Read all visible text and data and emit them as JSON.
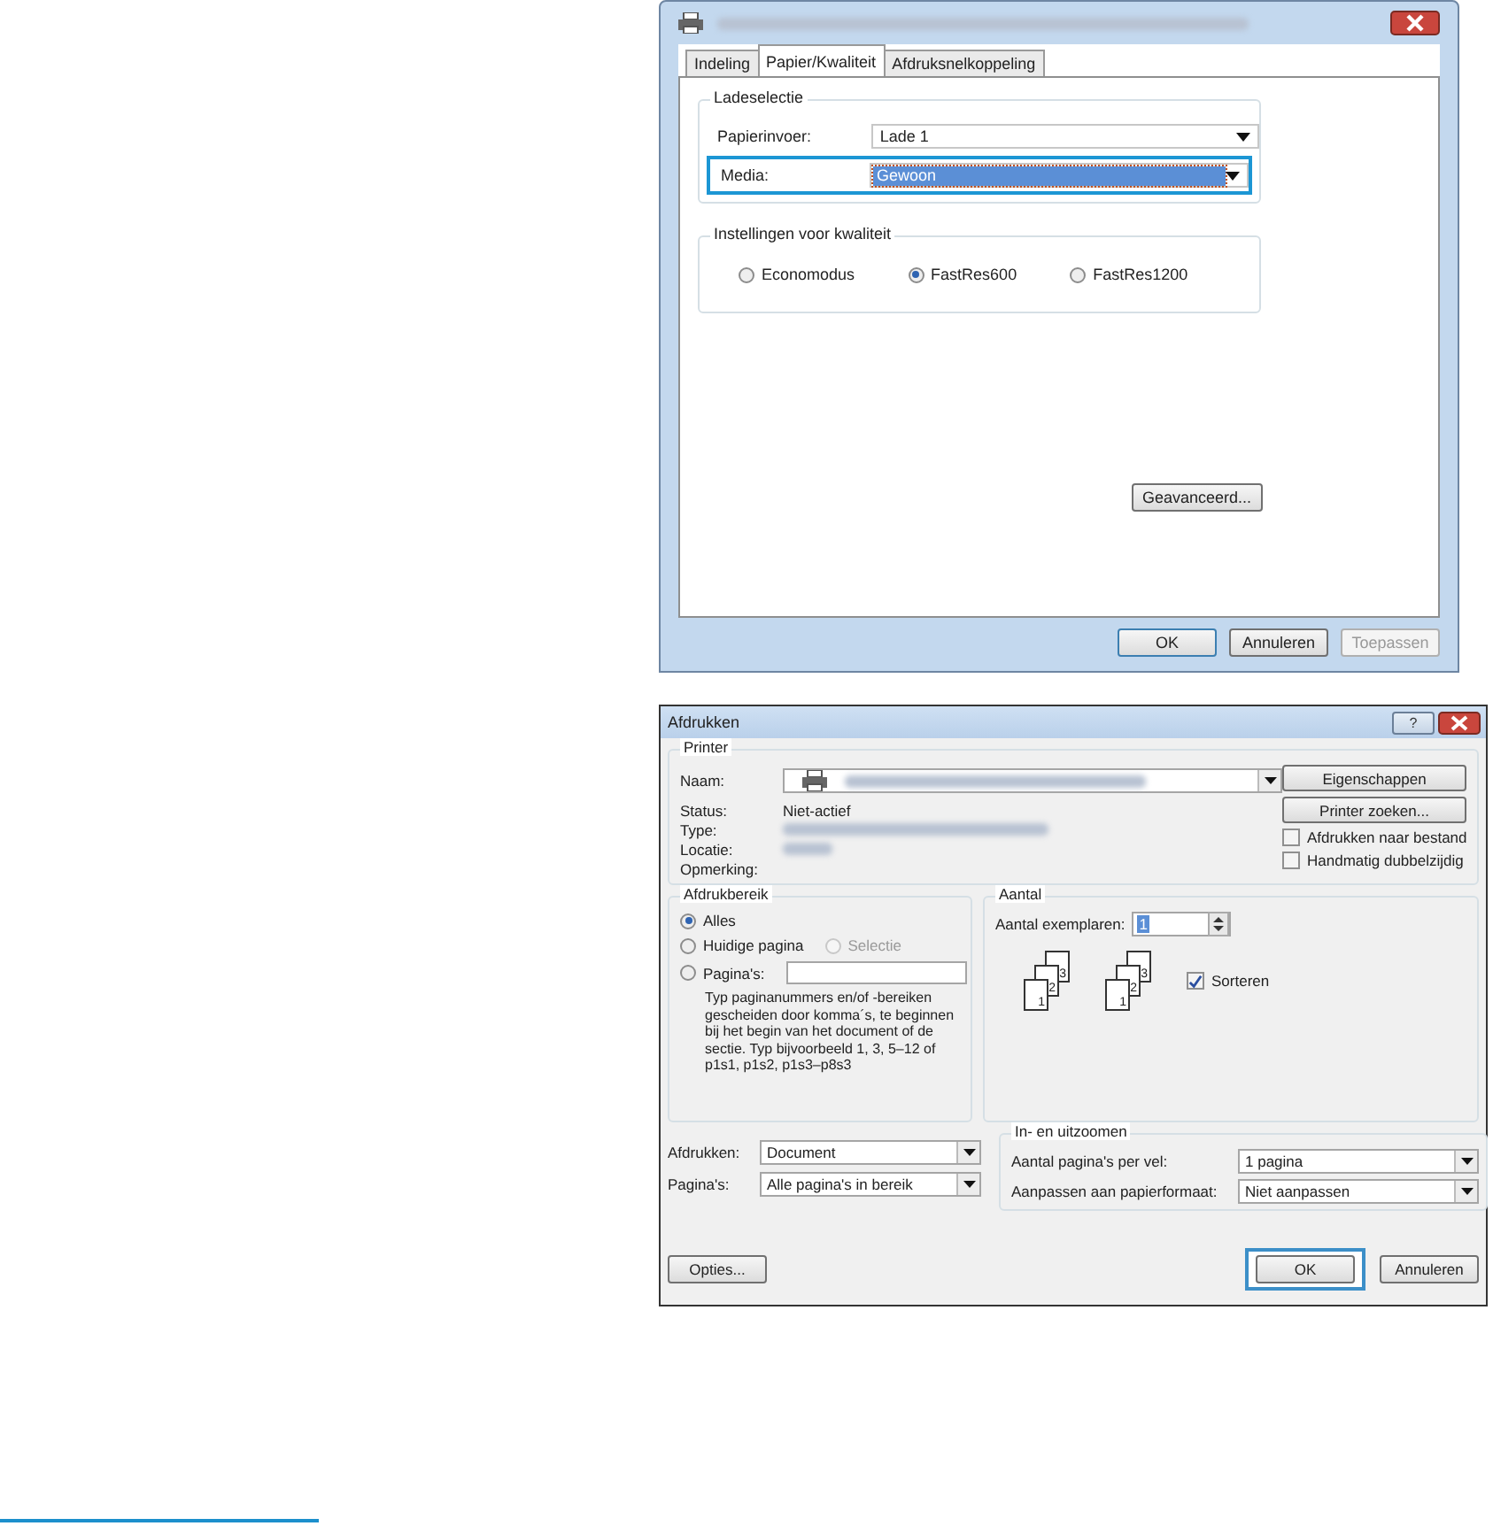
{
  "settings_dialog": {
    "tabs": [
      {
        "label": "Indeling",
        "selected": false
      },
      {
        "label": "Papier/Kwaliteit",
        "selected": true
      },
      {
        "label": "Afdruksnelkoppeling",
        "selected": false
      }
    ],
    "tray_group": {
      "title": "Ladeselectie",
      "rows": [
        {
          "label": "Papierinvoer:",
          "value": "Lade 1",
          "highlighted": false
        },
        {
          "label": "Media:",
          "value": "Gewoon",
          "highlighted": true
        }
      ]
    },
    "quality_group": {
      "title": "Instellingen voor kwaliteit",
      "options": [
        {
          "label": "Economodus",
          "selected": false
        },
        {
          "label": "FastRes600",
          "selected": true
        },
        {
          "label": "FastRes1200",
          "selected": false
        }
      ]
    },
    "advanced_button": "Geavanceerd...",
    "buttons": [
      {
        "label": "OK",
        "disabled": false,
        "default": true
      },
      {
        "label": "Annuleren",
        "disabled": false,
        "default": false
      },
      {
        "label": "Toepassen",
        "disabled": true,
        "default": false
      }
    ]
  },
  "print_dialog": {
    "title": "Afdrukken",
    "help_button": "?",
    "printer_group": {
      "title": "Printer",
      "name_label": "Naam:",
      "info": [
        {
          "label": "Status:",
          "kind": "text",
          "value": "Niet-actief"
        },
        {
          "label": "Type:",
          "kind": "blurred"
        },
        {
          "label": "Locatie:",
          "kind": "blurred"
        },
        {
          "label": "Opmerking:",
          "kind": "empty"
        }
      ],
      "buttons": [
        "Eigenschappen",
        "Printer zoeken..."
      ],
      "checkboxes": [
        {
          "label": "Afdrukken naar bestand",
          "checked": false
        },
        {
          "label": "Handmatig dubbelzijdig",
          "checked": false
        }
      ]
    },
    "range_group": {
      "title": "Afdrukbereik",
      "options": [
        {
          "label": "Alles",
          "kind": "radio",
          "selected": true,
          "disabled": false
        },
        {
          "label": "Huidige pagina",
          "kind": "radio",
          "selected": false,
          "disabled": false
        },
        {
          "label": "Selectie",
          "kind": "radio",
          "selected": false,
          "disabled": true
        },
        {
          "label": "Pagina's:",
          "kind": "radio_input",
          "selected": false,
          "disabled": false
        }
      ],
      "hint": "Typ paginanummers en/of -bereiken gescheiden door komma´s, te beginnen bij het begin van het document of de sectie. Typ bijvoorbeeld 1, 3, 5–12 of p1s1, p1s2, p1s3–p8s3"
    },
    "copies_group": {
      "title": "Aantal",
      "copies_label": "Aantal exemplaren:",
      "copies_value": "1",
      "collate_stacks": [
        [
          "3",
          "2",
          "1"
        ],
        [
          "3",
          "2",
          "1"
        ]
      ],
      "collate": {
        "label": "Sorteren",
        "checked": true
      }
    },
    "print_what": [
      {
        "label": "Afdrukken:",
        "value": "Document"
      },
      {
        "label": "Pagina's:",
        "value": "Alle pagina's in bereik"
      }
    ],
    "zoom_group": {
      "title": "In- en uitzoomen",
      "rows": [
        {
          "label": "Aantal pagina's per vel:",
          "value": "1 pagina"
        },
        {
          "label": "Aanpassen aan papierformaat:",
          "value": "Niet aanpassen"
        }
      ]
    },
    "options_button": "Opties...",
    "buttons": [
      {
        "label": "OK",
        "highlighted": true
      },
      {
        "label": "Annuleren",
        "highlighted": false
      }
    ]
  }
}
